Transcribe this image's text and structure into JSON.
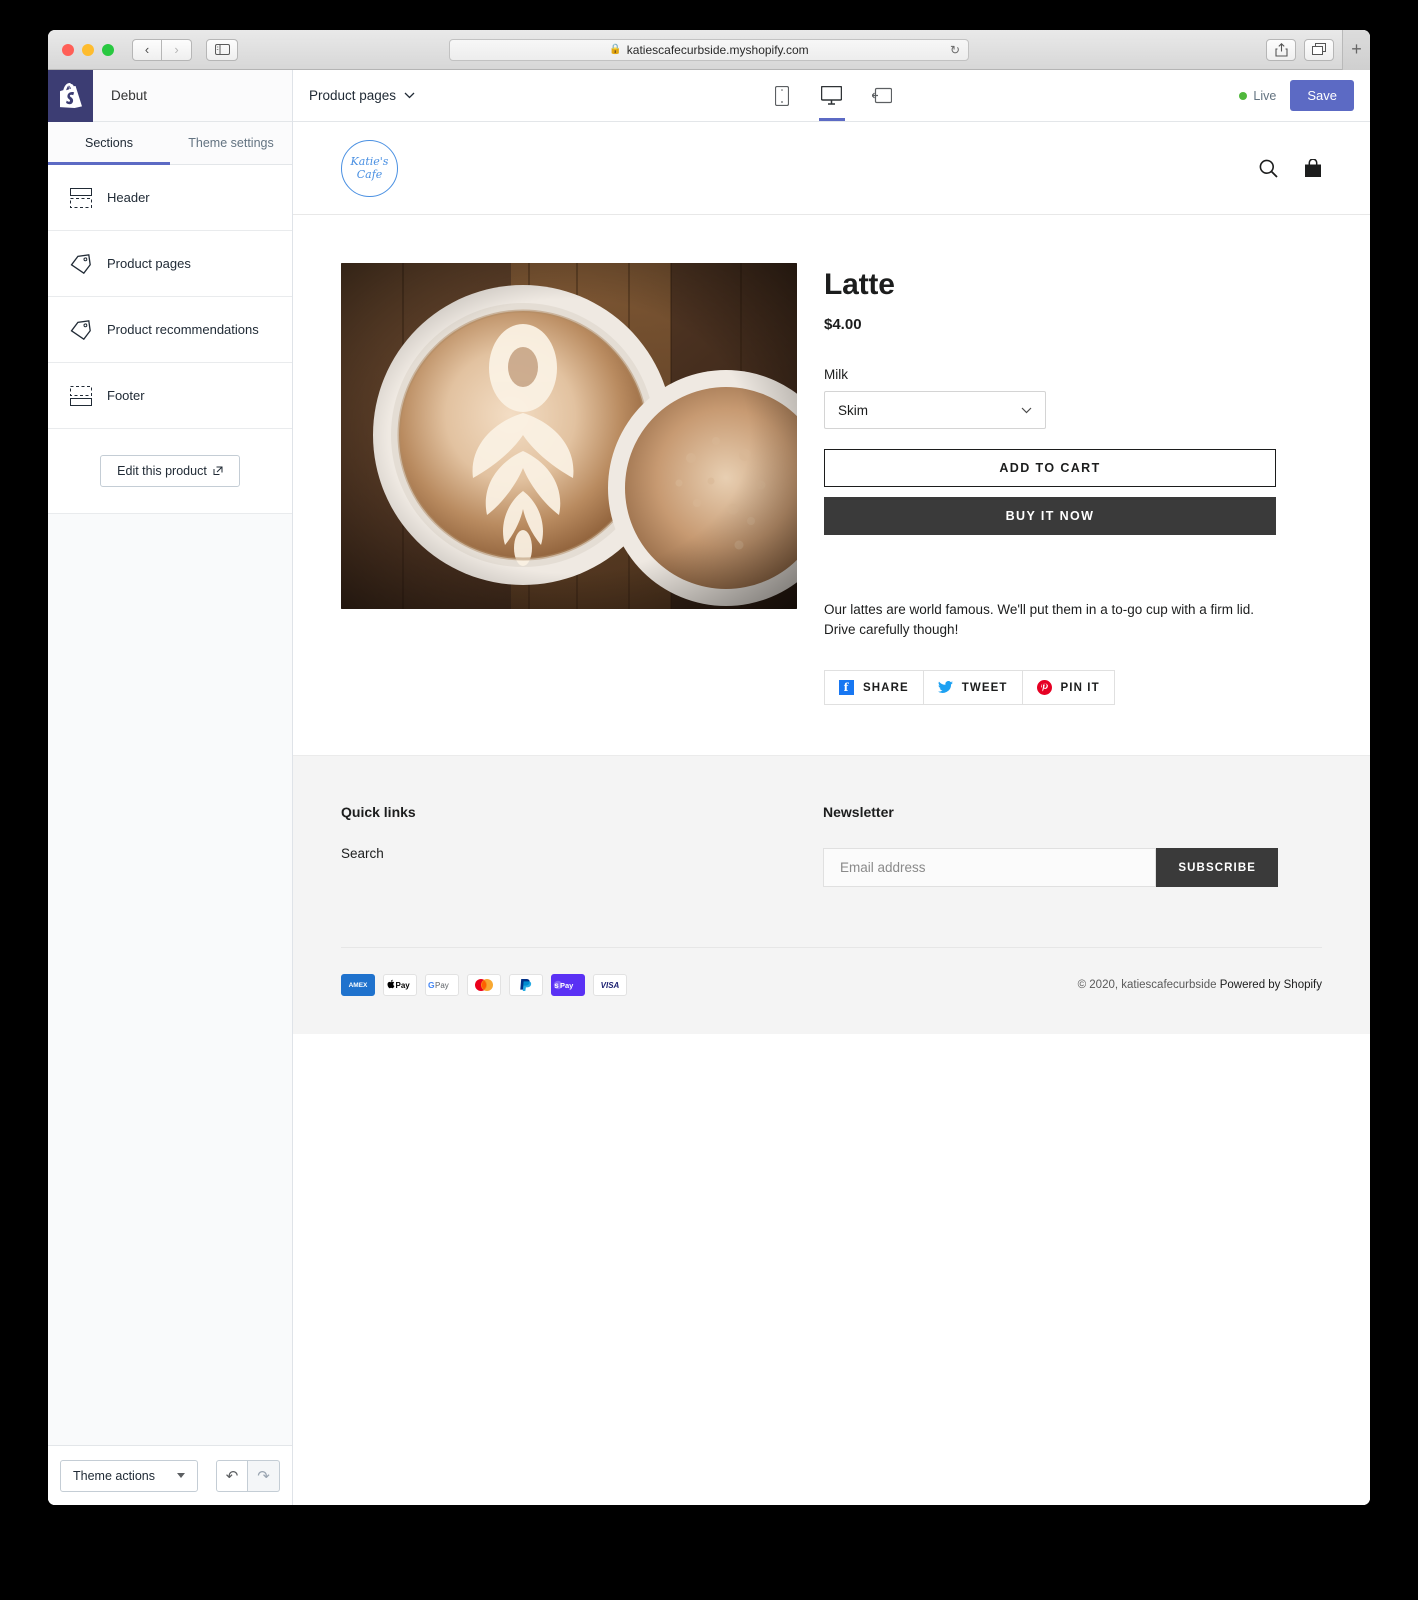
{
  "browser": {
    "url": "katiescafecurbside.myshopify.com",
    "lock_icon": "lock-icon",
    "back_glyph": "‹",
    "forward_glyph": "›",
    "reload_glyph": "↻",
    "new_tab_glyph": "+"
  },
  "sidebar": {
    "theme_name": "Debut",
    "tabs": [
      {
        "label": "Sections",
        "active": true
      },
      {
        "label": "Theme settings",
        "active": false
      }
    ],
    "sections": [
      {
        "label": "Header",
        "icon": "header-section-icon"
      },
      {
        "label": "Product pages",
        "icon": "tag-icon"
      },
      {
        "label": "Product recommendations",
        "icon": "tag-icon"
      },
      {
        "label": "Footer",
        "icon": "footer-section-icon"
      }
    ],
    "edit_product_label": "Edit this product",
    "edit_product_icon": "external-link-icon",
    "theme_actions_label": "Theme actions",
    "undo_glyph": "↶",
    "redo_glyph": "↷"
  },
  "topbar": {
    "page_selector": "Product pages",
    "chevron": "∨",
    "devices": [
      {
        "name": "mobile",
        "active": false
      },
      {
        "name": "desktop",
        "active": true
      },
      {
        "name": "fullscreen",
        "active": false
      }
    ],
    "live_label": "Live",
    "save_label": "Save",
    "live_color": "#50b83c",
    "accent_color": "#5c6ac4"
  },
  "store": {
    "logo_line1": "Katie's",
    "logo_line2": "Cafe",
    "logo_color": "#4a90e2",
    "header_icons": [
      "search-icon",
      "cart-icon"
    ]
  },
  "product": {
    "title": "Latte",
    "price": "$4.00",
    "option_label": "Milk",
    "option_value": "Skim",
    "option_choices": [
      "Skim"
    ],
    "add_to_cart_label": "ADD TO CART",
    "buy_now_label": "BUY IT NOW",
    "description": "Our lattes are world famous. We'll put them in a to-go cup with a firm lid. Drive carefully though!",
    "share_buttons": [
      {
        "label": "SHARE",
        "icon": "facebook-icon",
        "glyph": "f",
        "color": "#1877f2"
      },
      {
        "label": "TWEET",
        "icon": "twitter-icon",
        "glyph": "ᵕ",
        "color": "#1da1f2"
      },
      {
        "label": "PIN IT",
        "icon": "pinterest-icon",
        "glyph": "ⓟ",
        "color": "#e60023"
      }
    ]
  },
  "footer": {
    "quick_links_title": "Quick links",
    "quick_links": [
      "Search"
    ],
    "newsletter_title": "Newsletter",
    "email_placeholder": "Email address",
    "subscribe_label": "SUBSCRIBE",
    "payment_methods": [
      {
        "name": "AMEX",
        "label": "AMEX",
        "class": "pay-amex"
      },
      {
        "name": "Apple Pay",
        "label": "Pay",
        "class": "pay-apple"
      },
      {
        "name": "Google Pay",
        "label": "G Pay",
        "class": "pay-gpay"
      },
      {
        "name": "Mastercard",
        "label": "",
        "class": "pay-mc"
      },
      {
        "name": "PayPal",
        "label": "",
        "class": "pay-pp"
      },
      {
        "name": "Shop Pay",
        "label": "⬡Pay",
        "class": "pay-shop"
      },
      {
        "name": "Visa",
        "label": "VISA",
        "class": "pay-visa"
      }
    ],
    "copyright": "© 2020, katiescafecurbside",
    "powered_by": "Powered by Shopify"
  }
}
